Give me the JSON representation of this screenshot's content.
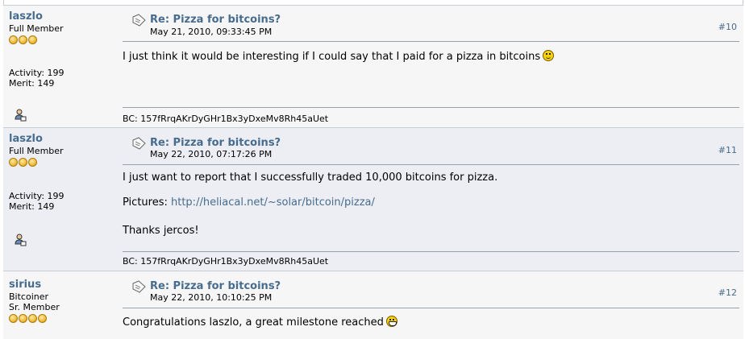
{
  "posts": [
    {
      "username": "laszlo",
      "rank": "Full Member",
      "stars": 3,
      "activity": "Activity: 199",
      "merit": "Merit: 149",
      "title": "Re: Pizza for bitcoins?",
      "date": "May 21, 2010, 09:33:45 PM",
      "number": "#10",
      "body": [
        "I just think it would be interesting if I could say that I paid for a pizza in bitcoins"
      ],
      "signature": "BC: 157fRrqAKrDyGHr1Bx3yDxeMv8Rh45aUet"
    },
    {
      "username": "laszlo",
      "rank": "Full Member",
      "stars": 3,
      "activity": "Activity: 199",
      "merit": "Merit: 149",
      "title": "Re: Pizza for bitcoins?",
      "date": "May 22, 2010, 07:17:26 PM",
      "number": "#11",
      "body": [
        "I just want to report that I successfully traded 10,000 bitcoins for pizza.",
        "Pictures: ",
        "Thanks jercos!"
      ],
      "link": "http://heliacal.net/~solar/bitcoin/pizza/",
      "signature": "BC: 157fRrqAKrDyGHr1Bx3yDxeMv8Rh45aUet"
    },
    {
      "username": "sirius",
      "title_custom": "Bitcoiner",
      "rank": "Sr. Member",
      "stars": 4,
      "title": "Re: Pizza for bitcoins?",
      "date": "May 22, 2010, 10:10:25 PM",
      "number": "#12",
      "body": [
        "Congratulations laszlo, a great milestone reached"
      ]
    }
  ],
  "icons": {
    "topic": "topic-doc-icon",
    "profile": "profile-person-icon",
    "smiley": "smiley-icon",
    "grin": "grin-icon",
    "star": "rank-star-icon"
  },
  "colors": {
    "link": "#476c8e",
    "post_bg_a": "#f6f6f6",
    "post_bg_b": "#eceef3",
    "border": "#c8cdd3"
  }
}
